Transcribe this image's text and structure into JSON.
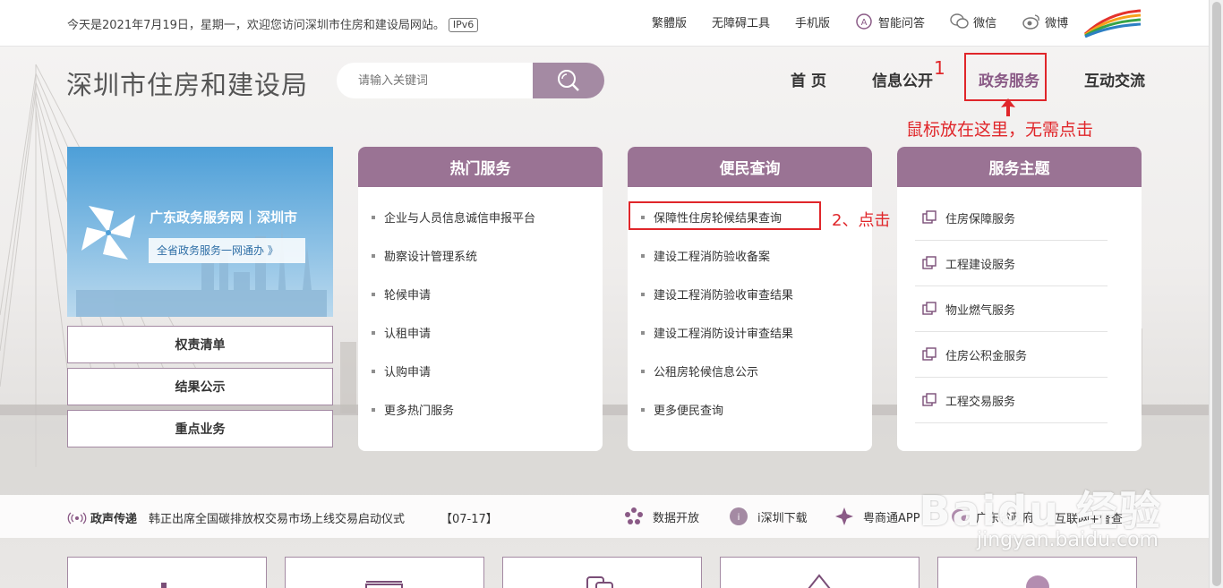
{
  "topbar": {
    "date_text": "今天是2021年7月19日，星期一，欢迎您访问深圳市住房和建设局网站。",
    "ipv6": "IPv6",
    "links": [
      {
        "label": "繁體版",
        "icon": ""
      },
      {
        "label": "无障碍工具",
        "icon": ""
      },
      {
        "label": "手机版",
        "icon": ""
      },
      {
        "label": "智能问答",
        "icon": "robot-icon"
      },
      {
        "label": "微信",
        "icon": "wechat-icon"
      },
      {
        "label": "微博",
        "icon": "weibo-icon"
      }
    ]
  },
  "header": {
    "site_title": "深圳市住房和建设局",
    "search_placeholder": "请输入关键词",
    "nav": [
      "首页",
      "信息公开",
      "政务服务",
      "互动交流"
    ]
  },
  "annotations": {
    "step1_number": "1",
    "step1_text": "鼠标放在这里，无需点击",
    "step2_text": "2、点击"
  },
  "banner": {
    "title": "广东政务服务网｜深圳市",
    "subtitle": "全省政务服务一网通办 》"
  },
  "left_buttons": [
    "权责清单",
    "结果公示",
    "重点业务"
  ],
  "hot_services": {
    "title": "热门服务",
    "items": [
      "企业与人员信息诚信申报平台",
      "勘察设计管理系统",
      "轮候申请",
      "认租申请",
      "认购申请",
      "更多热门服务"
    ]
  },
  "citizen_query": {
    "title": "便民查询",
    "items": [
      "保障性住房轮候结果查询",
      "建设工程消防验收备案",
      "建设工程消防验收审查结果",
      "建设工程消防设计审查结果",
      "公租房轮候信息公示",
      "更多便民查询"
    ]
  },
  "service_themes": {
    "title": "服务主题",
    "items": [
      "住房保障服务",
      "工程建设服务",
      "物业燃气服务",
      "住房公积金服务",
      "工程交易服务"
    ]
  },
  "news_strip": {
    "label": "政声传递",
    "headline": "韩正出席全国碳排放权交易市场上线交易启动仪式",
    "date": "【07-17】",
    "links": [
      "数据开放",
      "i深圳下载",
      "粤商通APP",
      "广东省政府",
      "互联网+督查"
    ]
  },
  "watermark": {
    "main": "Baidu 经验",
    "sub": "jingyan.baidu.com"
  },
  "colors": {
    "accent": "#9a7394",
    "search_button": "#a48aa3",
    "annotation_red": "#e0262a"
  }
}
